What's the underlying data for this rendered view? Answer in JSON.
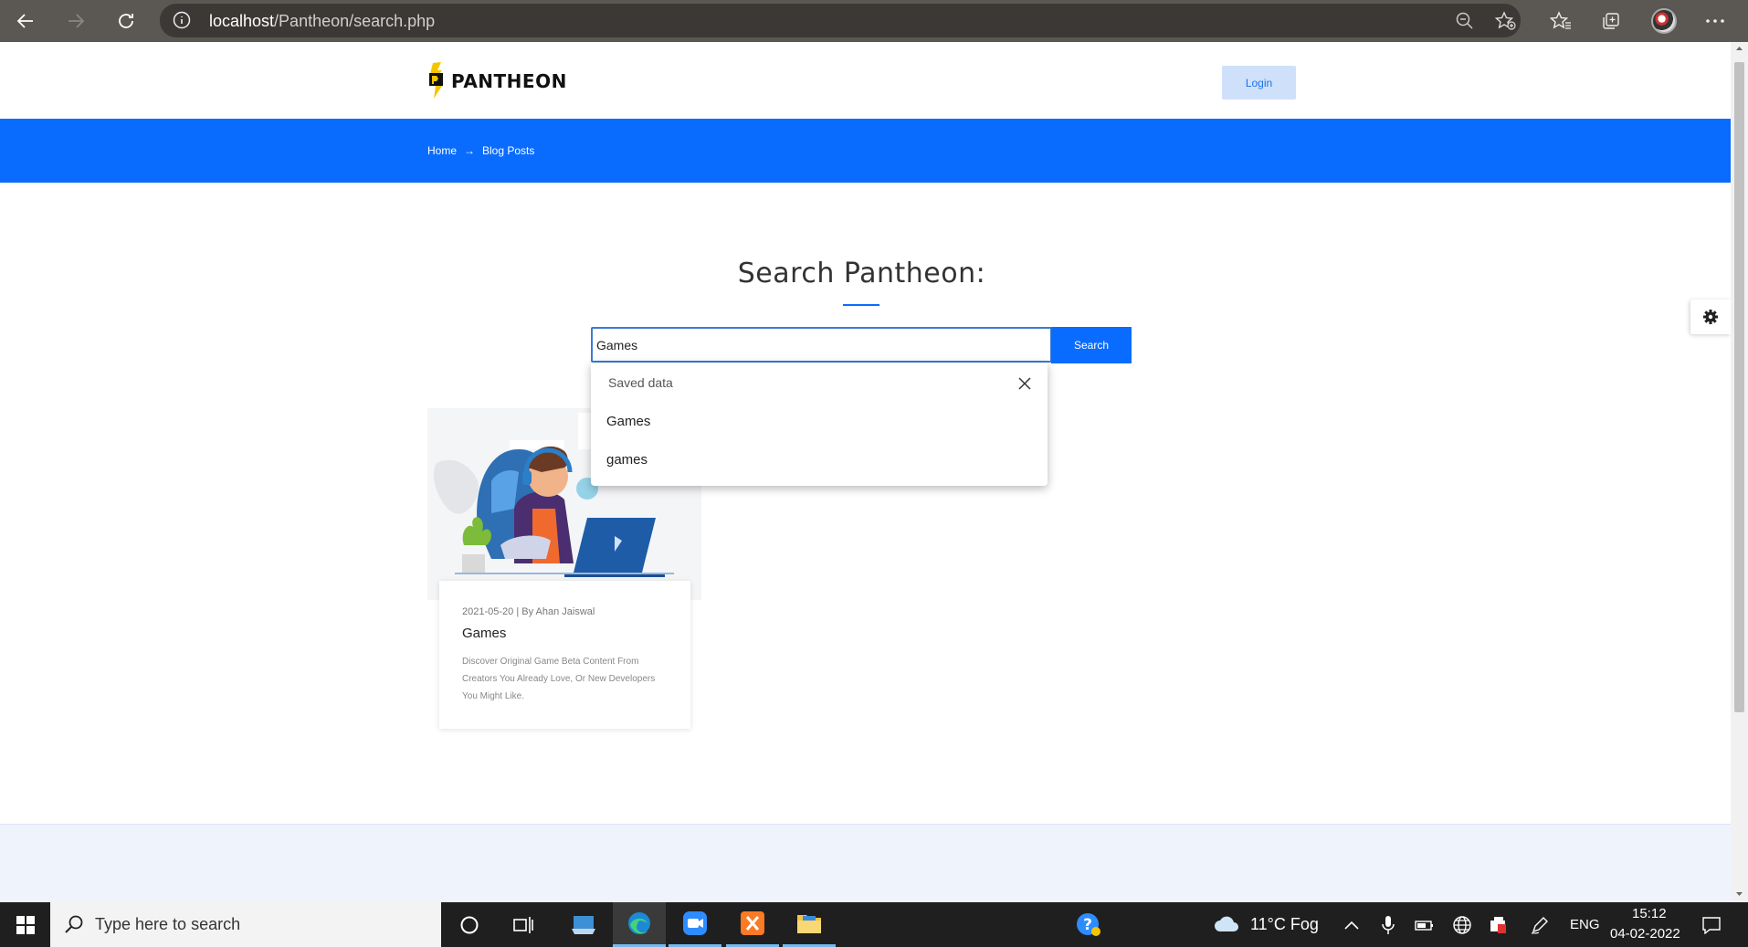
{
  "browser": {
    "url_host": "localhost",
    "url_path": "/Pantheon/search.php"
  },
  "site": {
    "logo_text": "PANTHEON",
    "login_label": "Login",
    "breadcrumb": [
      "Home",
      "Blog Posts"
    ],
    "breadcrumb_arrow": "→"
  },
  "search": {
    "title": "Search Pantheon:",
    "input_value": "Games",
    "button_label": "Search"
  },
  "autocomplete": {
    "header": "Saved data",
    "items": [
      "Games",
      "games"
    ]
  },
  "blog_card": {
    "meta": "2021-05-20 | By Ahan Jaiswal",
    "title": "Games",
    "description": "Discover Original Game Beta Content From Creators You Already Love, Or New Developers You Might Like."
  },
  "taskbar": {
    "search_placeholder": "Type here to search",
    "weather": "11°C  Fog",
    "language": "ENG",
    "time": "15:12",
    "date": "04-02-2022"
  },
  "colors": {
    "accent": "#0a6cff",
    "login_bg": "#cfe0fa"
  }
}
